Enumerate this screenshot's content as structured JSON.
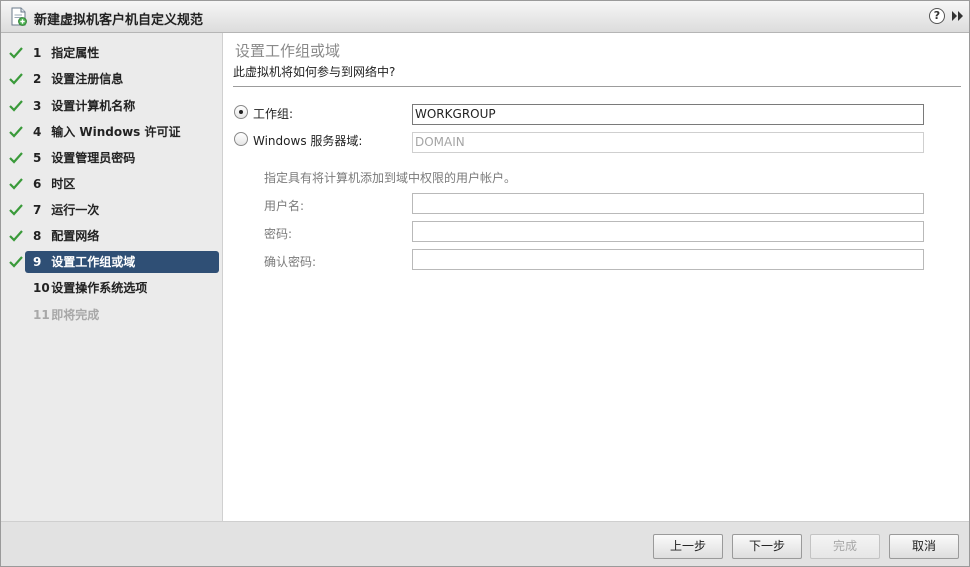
{
  "window": {
    "title": "新建虚拟机客户机自定义规范",
    "help_glyph": "?"
  },
  "steps": [
    {
      "num": "1",
      "label": "指定属性",
      "done": true
    },
    {
      "num": "2",
      "label": "设置注册信息",
      "done": true
    },
    {
      "num": "3",
      "label": "设置计算机名称",
      "done": true
    },
    {
      "num": "4",
      "label": "输入 Windows 许可证",
      "done": true
    },
    {
      "num": "5",
      "label": "设置管理员密码",
      "done": true
    },
    {
      "num": "6",
      "label": "时区",
      "done": true
    },
    {
      "num": "7",
      "label": "运行一次",
      "done": true
    },
    {
      "num": "8",
      "label": "配置网络",
      "done": true
    },
    {
      "num": "9",
      "label": "设置工作组或域",
      "done": true,
      "active": true
    },
    {
      "num": "10",
      "label": "设置操作系统选项",
      "done": false
    },
    {
      "num": "11",
      "label": "即将完成",
      "done": false,
      "disabled": true
    }
  ],
  "content": {
    "title": "设置工作组或域",
    "subtitle": "此虚拟机将如何参与到网络中?",
    "workgroup": {
      "label": "工作组:",
      "value": "WORKGROUP",
      "selected": true
    },
    "domain": {
      "label": "Windows 服务器域:",
      "placeholder": "DOMAIN",
      "selected": false
    },
    "credentials_hint": "指定具有将计算机添加到域中权限的用户帐户。",
    "username_label": "用户名:",
    "password_label": "密码:",
    "confirm_password_label": "确认密码:"
  },
  "footer": {
    "back": "上一步",
    "next": "下一步",
    "finish": "完成",
    "cancel": "取消"
  },
  "colors": {
    "accent": "#2f4f75",
    "check": "#3a9a3a"
  }
}
